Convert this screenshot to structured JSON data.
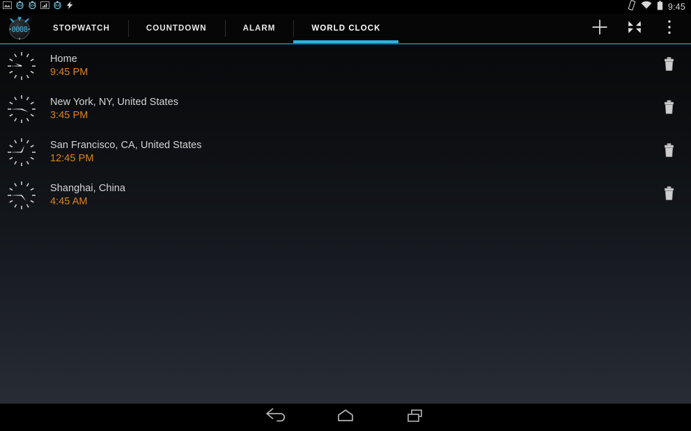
{
  "statusbar": {
    "time": "9:45",
    "left_icons": [
      {
        "name": "screenshot-icon"
      },
      {
        "name": "stopwatch-notification-icon"
      },
      {
        "name": "stopwatch-notification-icon-2"
      },
      {
        "name": "signal-bars-icon"
      },
      {
        "name": "stopwatch-notification-icon-3"
      },
      {
        "name": "charging-bolt-icon"
      }
    ],
    "right_icons": [
      {
        "name": "vibrate-icon"
      },
      {
        "name": "wifi-icon"
      },
      {
        "name": "battery-icon"
      }
    ]
  },
  "actionbar": {
    "app_icon_label": "0008",
    "tabs": [
      {
        "label": "STOPWATCH",
        "active": false,
        "name": "tab-stopwatch"
      },
      {
        "label": "COUNTDOWN",
        "active": false,
        "name": "tab-countdown"
      },
      {
        "label": "ALARM",
        "active": false,
        "name": "tab-alarm"
      },
      {
        "label": "WORLD CLOCK",
        "active": true,
        "name": "tab-world-clock"
      }
    ],
    "actions": [
      {
        "name": "add-city-button",
        "icon": "plus-icon"
      },
      {
        "name": "fullscreen-button",
        "icon": "expand-icon"
      },
      {
        "name": "overflow-menu-button",
        "icon": "more-vertical-icon"
      }
    ],
    "accent_color": "#29b6e8"
  },
  "world_clock": {
    "items": [
      {
        "city": "Home",
        "time": "9:45 PM",
        "hour_deg": 292.5,
        "minute_deg": 270
      },
      {
        "city": "New York, NY, United States",
        "time": "3:45 PM",
        "hour_deg": 112.5,
        "minute_deg": 270
      },
      {
        "city": "San Francisco, CA, United States",
        "time": "12:45 PM",
        "hour_deg": 22.5,
        "minute_deg": 270
      },
      {
        "city": "Shanghai, China",
        "time": "4:45 AM",
        "hour_deg": 142.5,
        "minute_deg": 270
      }
    ],
    "delete_label": "Delete",
    "time_color": "#e08214",
    "city_color": "#d4d4d4"
  },
  "navbar": {
    "buttons": [
      {
        "name": "nav-back-button",
        "icon": "back-arrow-icon"
      },
      {
        "name": "nav-home-button",
        "icon": "home-icon"
      },
      {
        "name": "nav-recents-button",
        "icon": "recents-icon"
      }
    ]
  }
}
